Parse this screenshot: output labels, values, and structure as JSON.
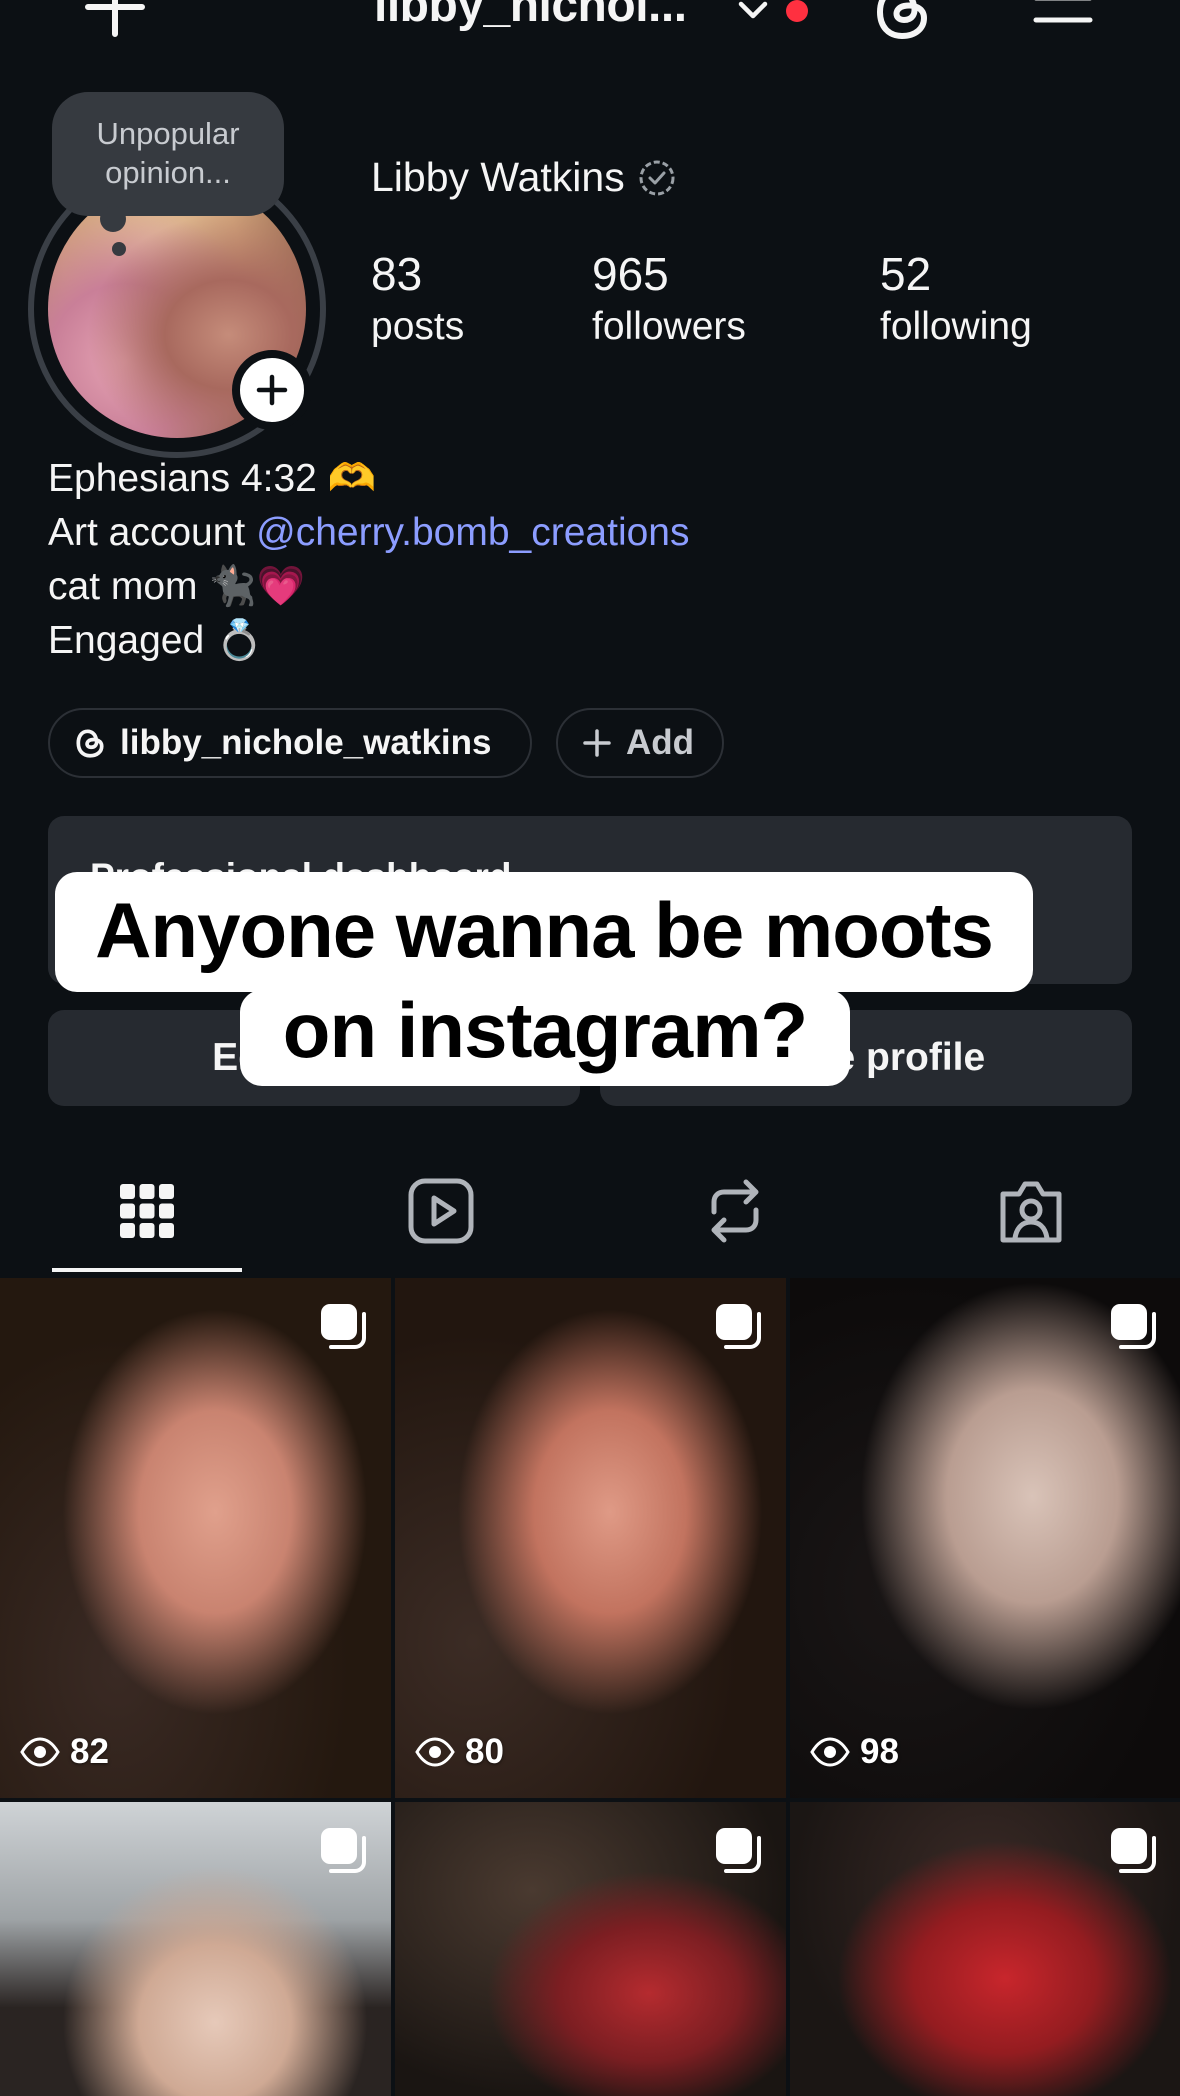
{
  "header": {
    "username": "libby_nichol...",
    "has_notification": true
  },
  "note": {
    "line1": "Unpopular",
    "line2": "opinion..."
  },
  "profile": {
    "full_name": "Libby Watkins",
    "stats": [
      {
        "value": "83",
        "label": "posts"
      },
      {
        "value": "965",
        "label": "followers"
      },
      {
        "value": "52",
        "label": "following"
      }
    ]
  },
  "bio": {
    "line1": "Ephesians 4:32 🫶",
    "line2_prefix": "Art account ",
    "line2_mention": "@cherry.bomb_creations",
    "line3": "cat mom 🐈‍⬛💗",
    "line4": "Engaged 💍"
  },
  "chips": {
    "threads_handle": "libby_nichole_watkins",
    "add_label": "Add"
  },
  "dashboard": {
    "label": "Professional dashboard"
  },
  "buttons": {
    "edit": "Edit profile",
    "share": "Share profile"
  },
  "caption": {
    "line1": "Anyone wanna be moots",
    "line2": "on instagram?"
  },
  "tabs": [
    "posts-grid",
    "reels",
    "reposts",
    "tagged"
  ],
  "grid": [
    {
      "views": "82",
      "multi": true
    },
    {
      "views": "80",
      "multi": true
    },
    {
      "views": "98",
      "multi": true
    },
    {
      "views": "",
      "multi": true
    },
    {
      "views": "",
      "multi": true
    },
    {
      "views": "",
      "multi": true
    }
  ],
  "colors": {
    "background": "#0c1014",
    "surface": "#262a30",
    "mention": "#8c9dff",
    "notification": "#ff3040"
  }
}
